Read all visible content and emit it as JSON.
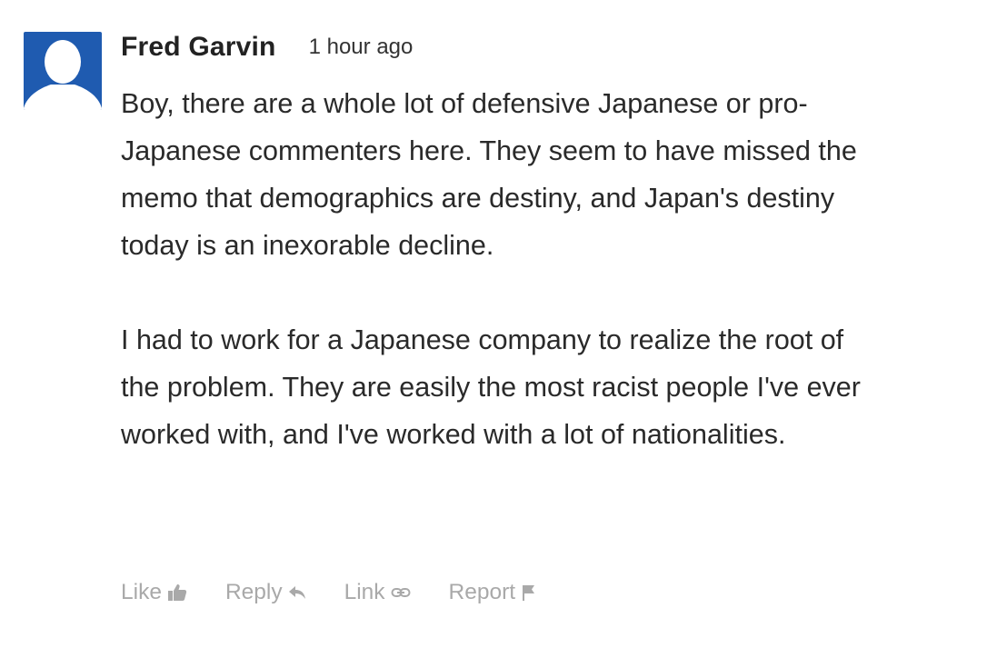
{
  "comment": {
    "author": "Fred Garvin",
    "timestamp": "1 hour ago",
    "paragraphs": [
      "Boy, there are a whole lot of defensive Japanese or pro-\nJapanese commenters here. They seem to have missed the\nmemo that demographics are destiny, and Japan's destiny\ntoday is an inexorable decline.",
      "I had to work for a Japanese company to realize the root of\nthe problem. They are easily the most racist people I've ever\nworked with, and I've worked with a lot of nationalities."
    ],
    "avatar": {
      "icon": "default-user-silhouette-icon",
      "background_color": "#1f5bb0",
      "silhouette_color": "#ffffff"
    }
  },
  "actions": {
    "like_label": "Like",
    "like_icon": "thumbs-up-icon",
    "reply_label": "Reply",
    "reply_icon": "reply-arrow-icon",
    "link_label": "Link",
    "link_icon": "chain-link-icon",
    "report_label": "Report",
    "report_icon": "flag-icon",
    "color": "#a9a9a9"
  }
}
